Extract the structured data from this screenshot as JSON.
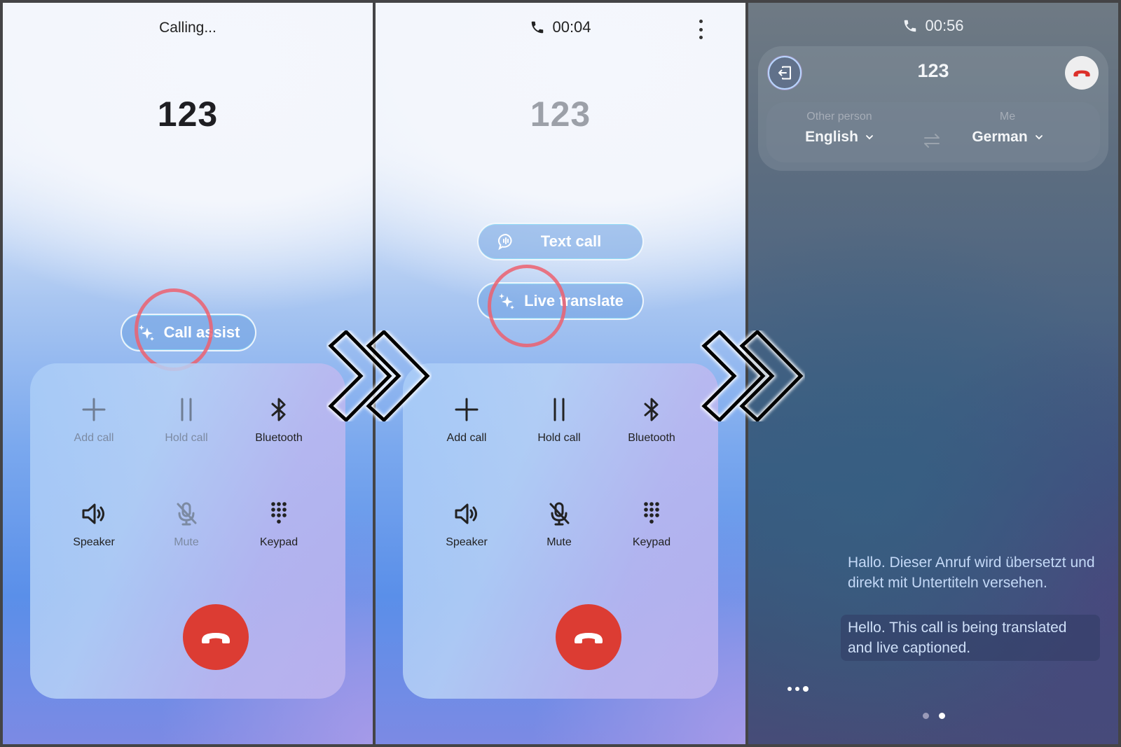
{
  "steps": [
    {
      "status": "Calling...",
      "number": "123",
      "assist_button": {
        "label": "Call assist",
        "icon": "sparkle-icon"
      },
      "controls": [
        {
          "label": "Add call",
          "icon": "plus-icon",
          "enabled": false
        },
        {
          "label": "Hold call",
          "icon": "pause-icon",
          "enabled": false
        },
        {
          "label": "Bluetooth",
          "icon": "bluetooth-icon",
          "enabled": true
        },
        {
          "label": "Speaker",
          "icon": "speaker-icon",
          "enabled": true
        },
        {
          "label": "Mute",
          "icon": "mic-off-icon",
          "enabled": false
        },
        {
          "label": "Keypad",
          "icon": "keypad-icon",
          "enabled": true
        }
      ],
      "end_call": {
        "icon": "hang-up-icon",
        "color": "#dc3c33"
      }
    },
    {
      "timer": "00:04",
      "number": "123",
      "menu_icon": "more-vertical-icon",
      "assist_options": [
        {
          "label": "Text call",
          "icon": "text-call-bubble-icon"
        },
        {
          "label": "Live translate",
          "icon": "sparkle-icon"
        }
      ],
      "controls": [
        {
          "label": "Add call",
          "icon": "plus-icon",
          "enabled": true
        },
        {
          "label": "Hold call",
          "icon": "pause-icon",
          "enabled": true
        },
        {
          "label": "Bluetooth",
          "icon": "bluetooth-icon",
          "enabled": true
        },
        {
          "label": "Speaker",
          "icon": "speaker-icon",
          "enabled": true
        },
        {
          "label": "Mute",
          "icon": "mic-off-icon",
          "enabled": true
        },
        {
          "label": "Keypad",
          "icon": "keypad-icon",
          "enabled": true
        }
      ],
      "end_call": {
        "icon": "hang-up-icon",
        "color": "#dc3c33"
      }
    },
    {
      "timer": "00:56",
      "number": "123",
      "other_person": {
        "caption": "Other person",
        "language": "English"
      },
      "me": {
        "caption": "Me",
        "language": "German"
      },
      "captions": {
        "original": "Hallo. Dieser Anruf wird übersetzt und direkt mit Untertiteln versehen.",
        "translated": "Hello. This call is being translated and live captioned."
      },
      "page_indicator": {
        "pages": 2,
        "current": 2
      }
    }
  ],
  "annotations": {
    "highlight_color": "#ec606e",
    "arrow": "double-chevron-right-icon"
  }
}
